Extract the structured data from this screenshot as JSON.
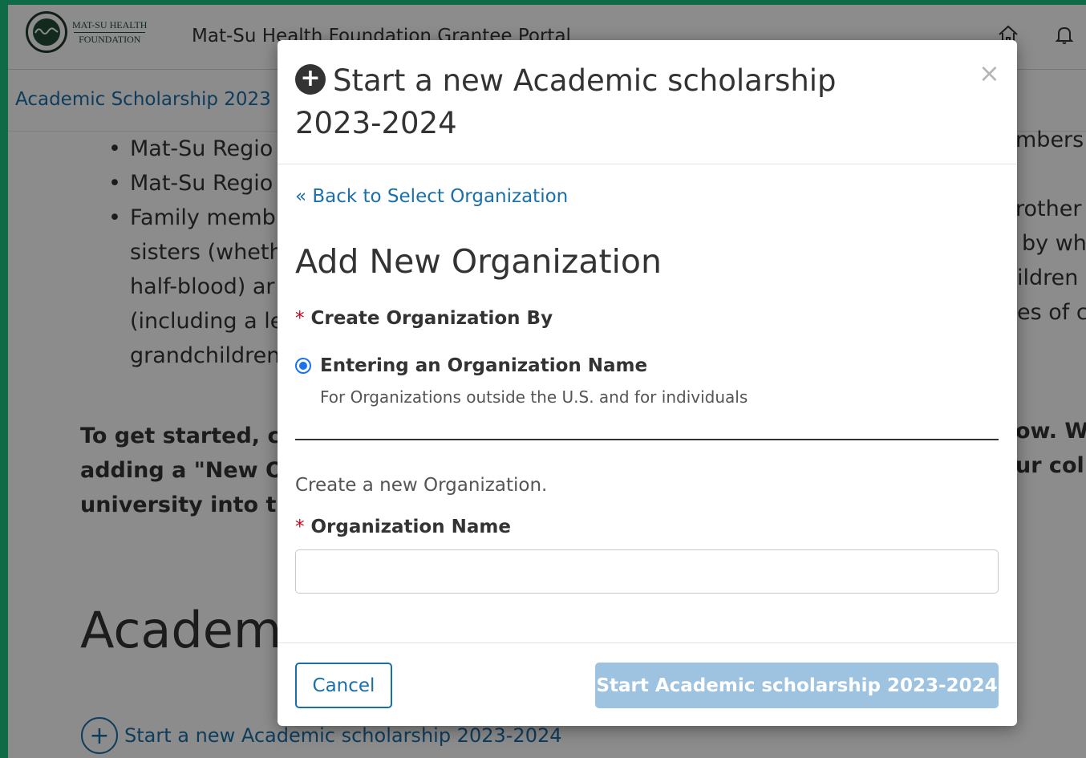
{
  "header": {
    "logo_line1": "MAT-SU HEALTH",
    "logo_line2": "FOUNDATION",
    "portal_title": "Mat-Su Health Foundation Grantee Portal",
    "home_icon": "home-icon",
    "bell_icon": "bell-icon"
  },
  "subbar": {
    "link": "Academic Scholarship 2023"
  },
  "background": {
    "bullets": [
      {
        "text": "Mat-Su Regio"
      },
      {
        "text": "Mat-Su Regio"
      },
      {
        "text": "Family memb",
        "lines": [
          "sisters (wheth",
          "half-blood) ar",
          "(including a le",
          "grandchildren"
        ]
      }
    ],
    "right_fragments": [
      "mbers",
      "rother",
      "by wh",
      "ildren",
      "es of c"
    ],
    "intro_lines": [
      "To get started, cli",
      "adding a \"New Or",
      "university into the"
    ],
    "intro_right": [
      "ow. Wh",
      "ur colle"
    ],
    "heading": "Academ",
    "start_link": "Start a new Academic scholarship 2023-2024"
  },
  "modal": {
    "title": "Start a new Academic scholarship 2023-2024",
    "close": "×",
    "back_link": "« Back to Select Organization",
    "section_title": "Add New Organization",
    "create_by_label": "Create Organization By",
    "radio_label": "Entering an Organization Name",
    "radio_help": "For Organizations outside the U.S. and for individuals",
    "create_text": "Create a new Organization.",
    "org_name_label": "Organization Name",
    "org_name_value": "",
    "cancel": "Cancel",
    "start": "Start Academic scholarship 2023-2024"
  },
  "colors": {
    "accent": "#1a6fa8",
    "required": "#d0021b",
    "start_button_disabled": "#9ec3e0",
    "page_border": "#0f6b45"
  }
}
